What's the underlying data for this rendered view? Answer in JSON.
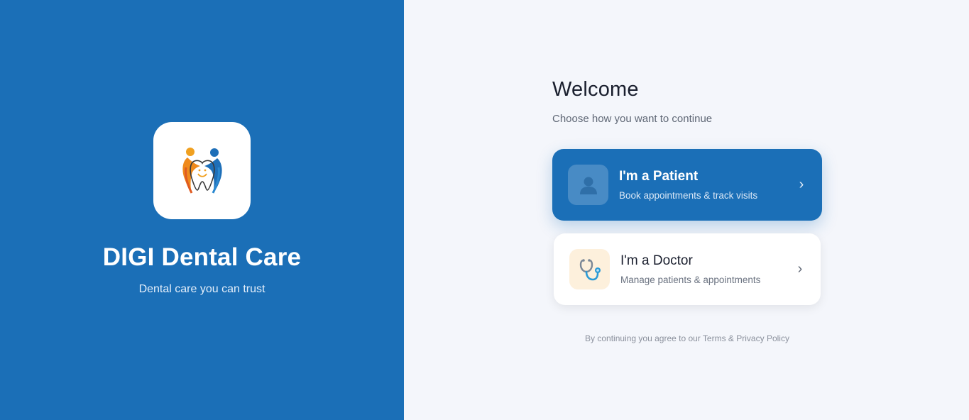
{
  "brand": {
    "name": "DIGI Dental Care",
    "tagline": "Dental care you can trust",
    "logo_icon": "tooth-family-logo"
  },
  "welcome": {
    "title": "Welcome",
    "subtitle": "Choose how you want to continue"
  },
  "roles": [
    {
      "title": "I'm a Patient",
      "description": "Book appointments & track visits",
      "icon": "person-icon",
      "accent": "#1b6fb7"
    },
    {
      "title": "I'm a Doctor",
      "description": "Manage patients & appointments",
      "icon": "stethoscope-icon",
      "accent": "#ffffff"
    }
  ],
  "footer": {
    "prefix": "By continuing you agree to our ",
    "terms": "Terms",
    "joiner": " & ",
    "privacy": "Privacy Policy"
  },
  "colors": {
    "brand_blue": "#1b6fb7",
    "page_bg": "#f4f6fb"
  }
}
